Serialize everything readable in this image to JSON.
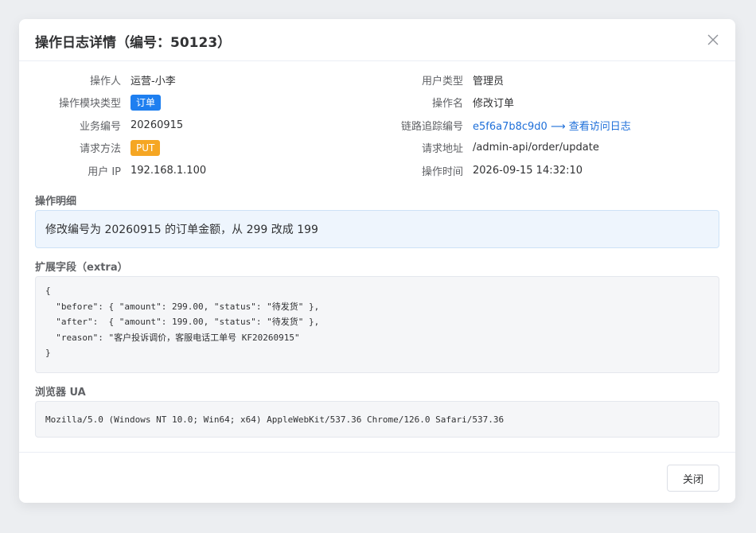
{
  "dialog": {
    "title": "操作日志详情（编号：50123）",
    "close_icon": "close-icon"
  },
  "fields": {
    "operator": {
      "label": "操作人",
      "value": "运营-小李"
    },
    "user_type": {
      "label": "用户类型",
      "value": "管理员"
    },
    "module_type": {
      "label": "操作模块类型",
      "value": "订单",
      "color": "#1e7ff0"
    },
    "operation_name": {
      "label": "操作名",
      "value": "修改订单"
    },
    "biz_id": {
      "label": "业务编号",
      "value": "20260915"
    },
    "trace_id": {
      "label": "链路追踪编号",
      "value": "e5f6a7b8c9d0 ⟶ 查看访问日志"
    },
    "request_method": {
      "label": "请求方法",
      "value": "PUT",
      "color": "#f5a623"
    },
    "request_url": {
      "label": "请求地址",
      "value": "/admin-api/order/update"
    },
    "user_ip": {
      "label": "用户 IP",
      "value": "192.168.1.100"
    },
    "operate_time": {
      "label": "操作时间",
      "value": "2026-09-15 14:32:10"
    }
  },
  "detail": {
    "title": "操作明细",
    "text": "修改编号为 20260915 的订单金额，从 299 改成 199"
  },
  "extra": {
    "title": "扩展字段（extra）",
    "lines": [
      "{",
      "  \"before\": { \"amount\": 299.00, \"status\": \"待发货\" },",
      "  \"after\":  { \"amount\": 199.00, \"status\": \"待发货\" },",
      "  \"reason\": \"客户投诉调价，客服电话工单号 KF20260915\"",
      "}"
    ]
  },
  "ua": {
    "title": "浏览器 UA",
    "text": "Mozilla/5.0 (Windows NT 10.0; Win64; x64) AppleWebKit/537.36 Chrome/126.0 Safari/537.36"
  },
  "footer": {
    "close_label": "关闭"
  }
}
